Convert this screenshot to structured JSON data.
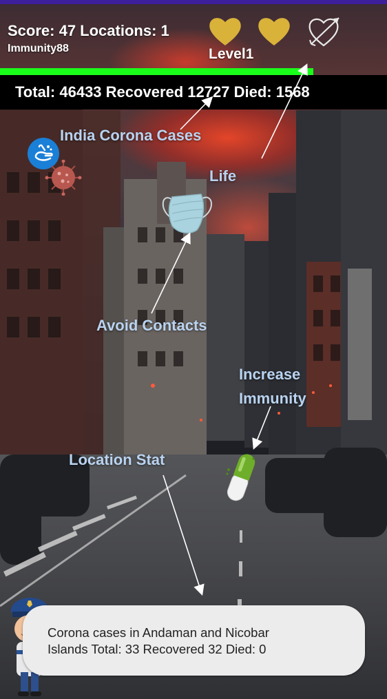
{
  "hud": {
    "score_line": "Score: 47 Locations: 1",
    "player_name": "Immunity88",
    "level": "Level1",
    "lives_remaining": 2,
    "lives_total": 3,
    "progress_fraction": 0.81
  },
  "stats": {
    "total": "Total: 46433",
    "recovered": "Recovered 12727",
    "died": "Died: 1568"
  },
  "annotations": {
    "india_cases": "India Corona Cases",
    "life": "Life",
    "avoid_contacts": "Avoid Contacts",
    "increase_immunity_1": "Increase",
    "increase_immunity_2": "Immunity",
    "location_stat": "Location Stat"
  },
  "location_bubble": {
    "line1": "Corona cases in Andaman and Nicobar",
    "line2": "Islands Total: 33 Recovered 32 Died: 0"
  },
  "icons": {
    "hand_wash": "hand-wash-icon",
    "virus": "virus-icon",
    "mask": "face-mask-icon",
    "pill": "capsule-icon",
    "police": "police-character",
    "heart": "heart-icon",
    "heart_broken": "heart-arrow-outline-icon"
  },
  "colors": {
    "heart_gold": "#d9b23a",
    "progress_green": "#1aff1a",
    "annotation_blue": "#b9d3f0",
    "top_strip": "#3d1f9b"
  }
}
